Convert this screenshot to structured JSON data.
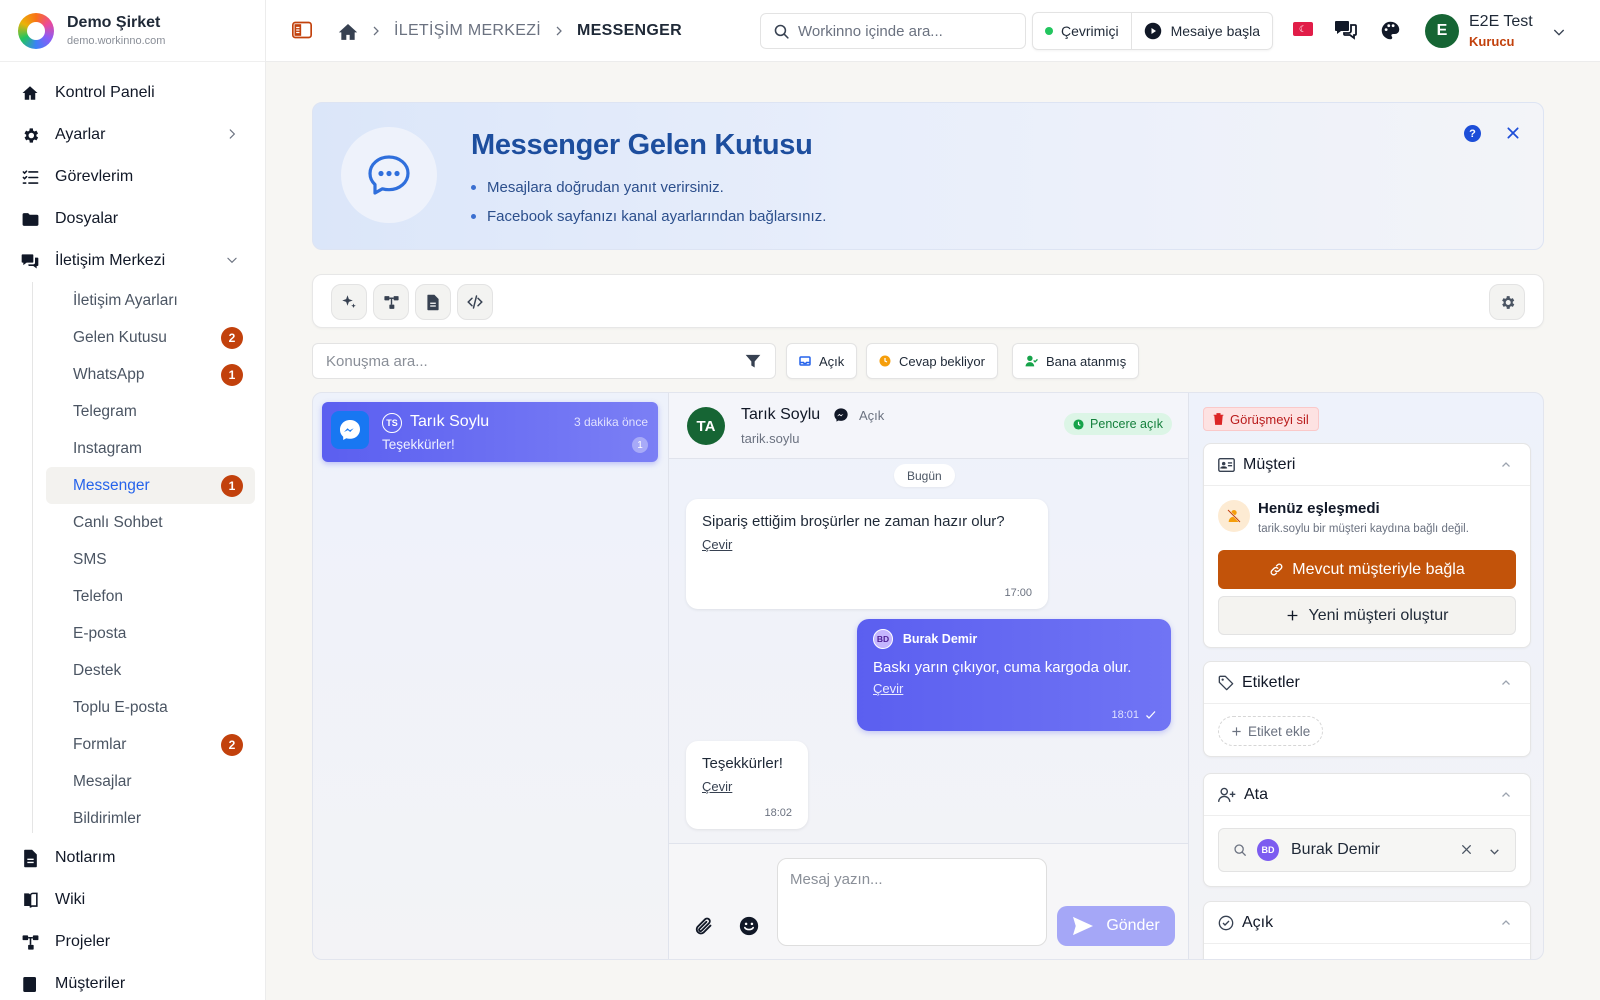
{
  "brand": {
    "name": "Demo Şirket",
    "domain": "demo.workinno.com"
  },
  "sidebar": {
    "items": [
      {
        "label": "Kontrol Paneli"
      },
      {
        "label": "Ayarlar"
      },
      {
        "label": "Görevlerim"
      },
      {
        "label": "Dosyalar"
      },
      {
        "label": "İletişim Merkezi"
      }
    ],
    "sub_items": [
      {
        "label": "İletişim Ayarları",
        "badge": ""
      },
      {
        "label": "Gelen Kutusu",
        "badge": "2"
      },
      {
        "label": "WhatsApp",
        "badge": "1"
      },
      {
        "label": "Telegram",
        "badge": ""
      },
      {
        "label": "Instagram",
        "badge": ""
      },
      {
        "label": "Messenger",
        "badge": "1"
      },
      {
        "label": "Canlı Sohbet",
        "badge": ""
      },
      {
        "label": "SMS",
        "badge": ""
      },
      {
        "label": "Telefon",
        "badge": ""
      },
      {
        "label": "E-posta",
        "badge": ""
      },
      {
        "label": "Destek",
        "badge": ""
      },
      {
        "label": "Toplu E-posta",
        "badge": ""
      },
      {
        "label": "Formlar",
        "badge": "2"
      },
      {
        "label": "Mesajlar",
        "badge": ""
      },
      {
        "label": "Bildirimler",
        "badge": ""
      }
    ],
    "bottom_items": [
      {
        "label": "Notlarım"
      },
      {
        "label": "Wiki"
      },
      {
        "label": "Projeler"
      },
      {
        "label": "Müşteriler"
      }
    ]
  },
  "topbar": {
    "breadcrumb": [
      "İLETİŞİM MERKEZİ",
      "MESSENGER"
    ],
    "search_placeholder": "Workinno içinde ara...",
    "status_label": "Çevrimiçi",
    "shift_label": "Mesaiye başla",
    "user_initial": "E",
    "user_name": "E2E Test",
    "user_role": "Kurucu"
  },
  "banner": {
    "title": "Messenger Gelen Kutusu",
    "bullets": [
      "Mesajlara doğrudan yanıt verirsiniz.",
      "Facebook sayfanızı kanal ayarlarından bağlarsınız."
    ],
    "help_label": "?"
  },
  "filters": {
    "search_placeholder": "Konuşma ara...",
    "chips": [
      {
        "label": "Açık",
        "color": "#2563eb"
      },
      {
        "label": "Cevap bekliyor",
        "color": "#f59e0b"
      },
      {
        "label": "Bana atanmış",
        "color": "#16a34a"
      }
    ]
  },
  "conversation": {
    "initials": "TS",
    "name": "Tarık Soylu",
    "time": "3 dakika önce",
    "preview": "Teşekkürler!",
    "unread": "1"
  },
  "chat": {
    "avatar": "TA",
    "name": "Tarık Soylu",
    "status": "Açık",
    "handle": "tarik.soylu",
    "window_badge": "Pencere açık",
    "day": "Bugün",
    "messages": [
      {
        "text": "Sipariş ettiğim broşürler ne zaman hazır olur?",
        "translate": "Çevir",
        "time": "17:00"
      },
      {
        "sender_initials": "BD",
        "sender": "Burak Demir",
        "text": "Baskı yarın çıkıyor, cuma kargoda olur.",
        "translate": "Çevir",
        "time": "18:01"
      },
      {
        "text": "Teşekkürler!",
        "translate": "Çevir",
        "time": "18:02"
      }
    ],
    "composer_placeholder": "Mesaj yazın...",
    "send_label": "Gönder"
  },
  "right": {
    "delete_label": "Görüşmeyi sil",
    "customer": {
      "title": "Müşteri",
      "match_title": "Henüz eşleşmedi",
      "match_sub": "tarik.soylu bir müşteri kaydına bağlı değil.",
      "link_label": "Mevcut müşteriyle bağla",
      "new_label": "Yeni müşteri oluştur"
    },
    "tags": {
      "title": "Etiketler",
      "add_label": "Etiket ekle"
    },
    "assign": {
      "title": "Ata",
      "initials": "BD",
      "name": "Burak Demir"
    },
    "status": {
      "title": "Açık"
    }
  },
  "colors": {
    "accent": "#5b5ff0",
    "brand_orange": "#c2410c",
    "online": "#22c55e"
  }
}
